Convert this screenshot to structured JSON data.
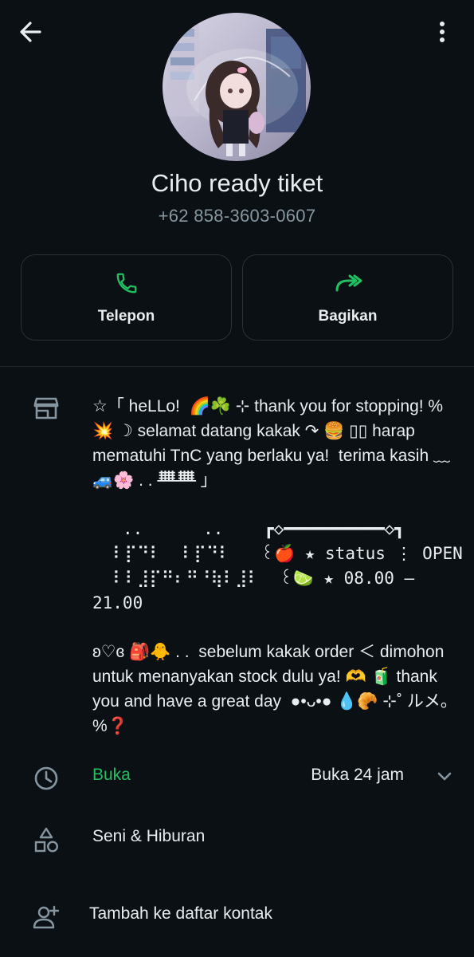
{
  "header": {
    "back_icon": "arrow-left-icon",
    "menu_icon": "more-vertical-icon"
  },
  "profile": {
    "name": "Ciho ready tiket",
    "phone": "+62 858-3603-0607"
  },
  "actions": {
    "call_label": "Telepon",
    "share_label": "Bagikan",
    "call_icon": "phone-icon",
    "share_icon": "forward-icon",
    "accent_color": "#21c063"
  },
  "business": {
    "store_icon": "store-icon",
    "description": {
      "p1": "☆「 heLLo!  🌈☘️ ⊹ thank you for stopping! % 💥 ☽ selamat datang kakak ↷ 🍔 ▯▯ harap mematuhi TnC yang berlaku ya!  terima kasih ﹏ 🚙🌸 . . ᚙᚙ 」",
      "p2_line1": "   ..      ..    ┏◇━━━━━━━━━━◇┓",
      "p2_line2": "  ⠇⡏⠙⠇  ⠇⡏⠙⠇   ꒰🍎 ★ status ⋮ OPEN",
      "p2_line3": "  ⠇⠇⣸⡏⠛⠆⠛⠘⢷⠇⣸⠇  ꒰🍋‍🟩 ★ 08.00 — 21.00",
      "p3": "ʚ♡ɞ 🎒🐥 . .  sebelum kakak order ＜ dimohon untuk menanyakan stock dulu ya! 🫶 🧃 thank you and have a great day  ●•ᴗ•● 💧🥐 ⊹˚ ルメ。 %❓"
    },
    "hours": {
      "icon": "clock-icon",
      "status": "Buka",
      "detail": "Buka 24 jam",
      "expand_icon": "chevron-down-icon",
      "status_color": "#21c063"
    },
    "category": {
      "icon": "shapes-icon",
      "label": "Seni & Hiburan"
    },
    "add_contact": {
      "icon": "add-person-icon",
      "label": "Tambah ke daftar kontak"
    }
  }
}
